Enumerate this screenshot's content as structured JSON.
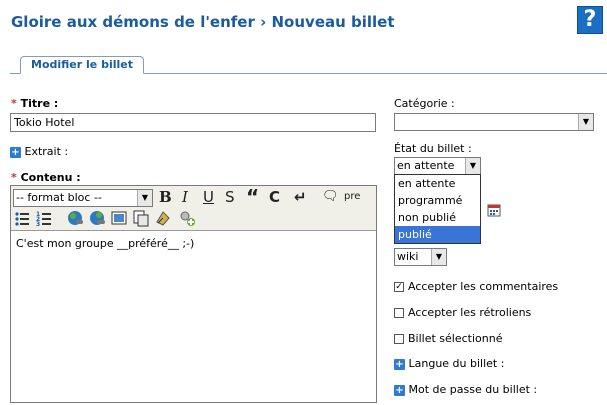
{
  "header": {
    "title": "Gloire aux démons de l'enfer › Nouveau billet",
    "help_label": "?"
  },
  "tabs": [
    {
      "label": "Modifier le billet"
    }
  ],
  "form": {
    "title_label": "Titre :",
    "required_mark": "*",
    "title_value": "Tokio Hotel",
    "excerpt_label": "Extrait :",
    "content_label": "Contenu :",
    "content_value": "C'est mon groupe __préféré__ ;-)"
  },
  "editor_toolbar": {
    "format_select": "-- format bloc --",
    "bold": "B",
    "italic": "I",
    "underline": "U",
    "strike": "S",
    "quote": "“",
    "code": "C",
    "linebreak": "↵",
    "pre": "pre"
  },
  "sidebar": {
    "category_label": "Catégorie :",
    "category_value": "",
    "status_label": "État du billet :",
    "status_value": "en attente",
    "status_options": [
      "en attente",
      "programmé",
      "non publié",
      "publié"
    ],
    "status_highlighted": "publié",
    "format_value": "wiki",
    "checkboxes": [
      {
        "label": "Accepter les commentaires",
        "checked": true
      },
      {
        "label": "Accepter les rétroliens",
        "checked": false
      },
      {
        "label": "Billet sélectionné",
        "checked": false
      }
    ],
    "language_label": "Langue du billet :",
    "password_label": "Mot de passe du billet :"
  }
}
